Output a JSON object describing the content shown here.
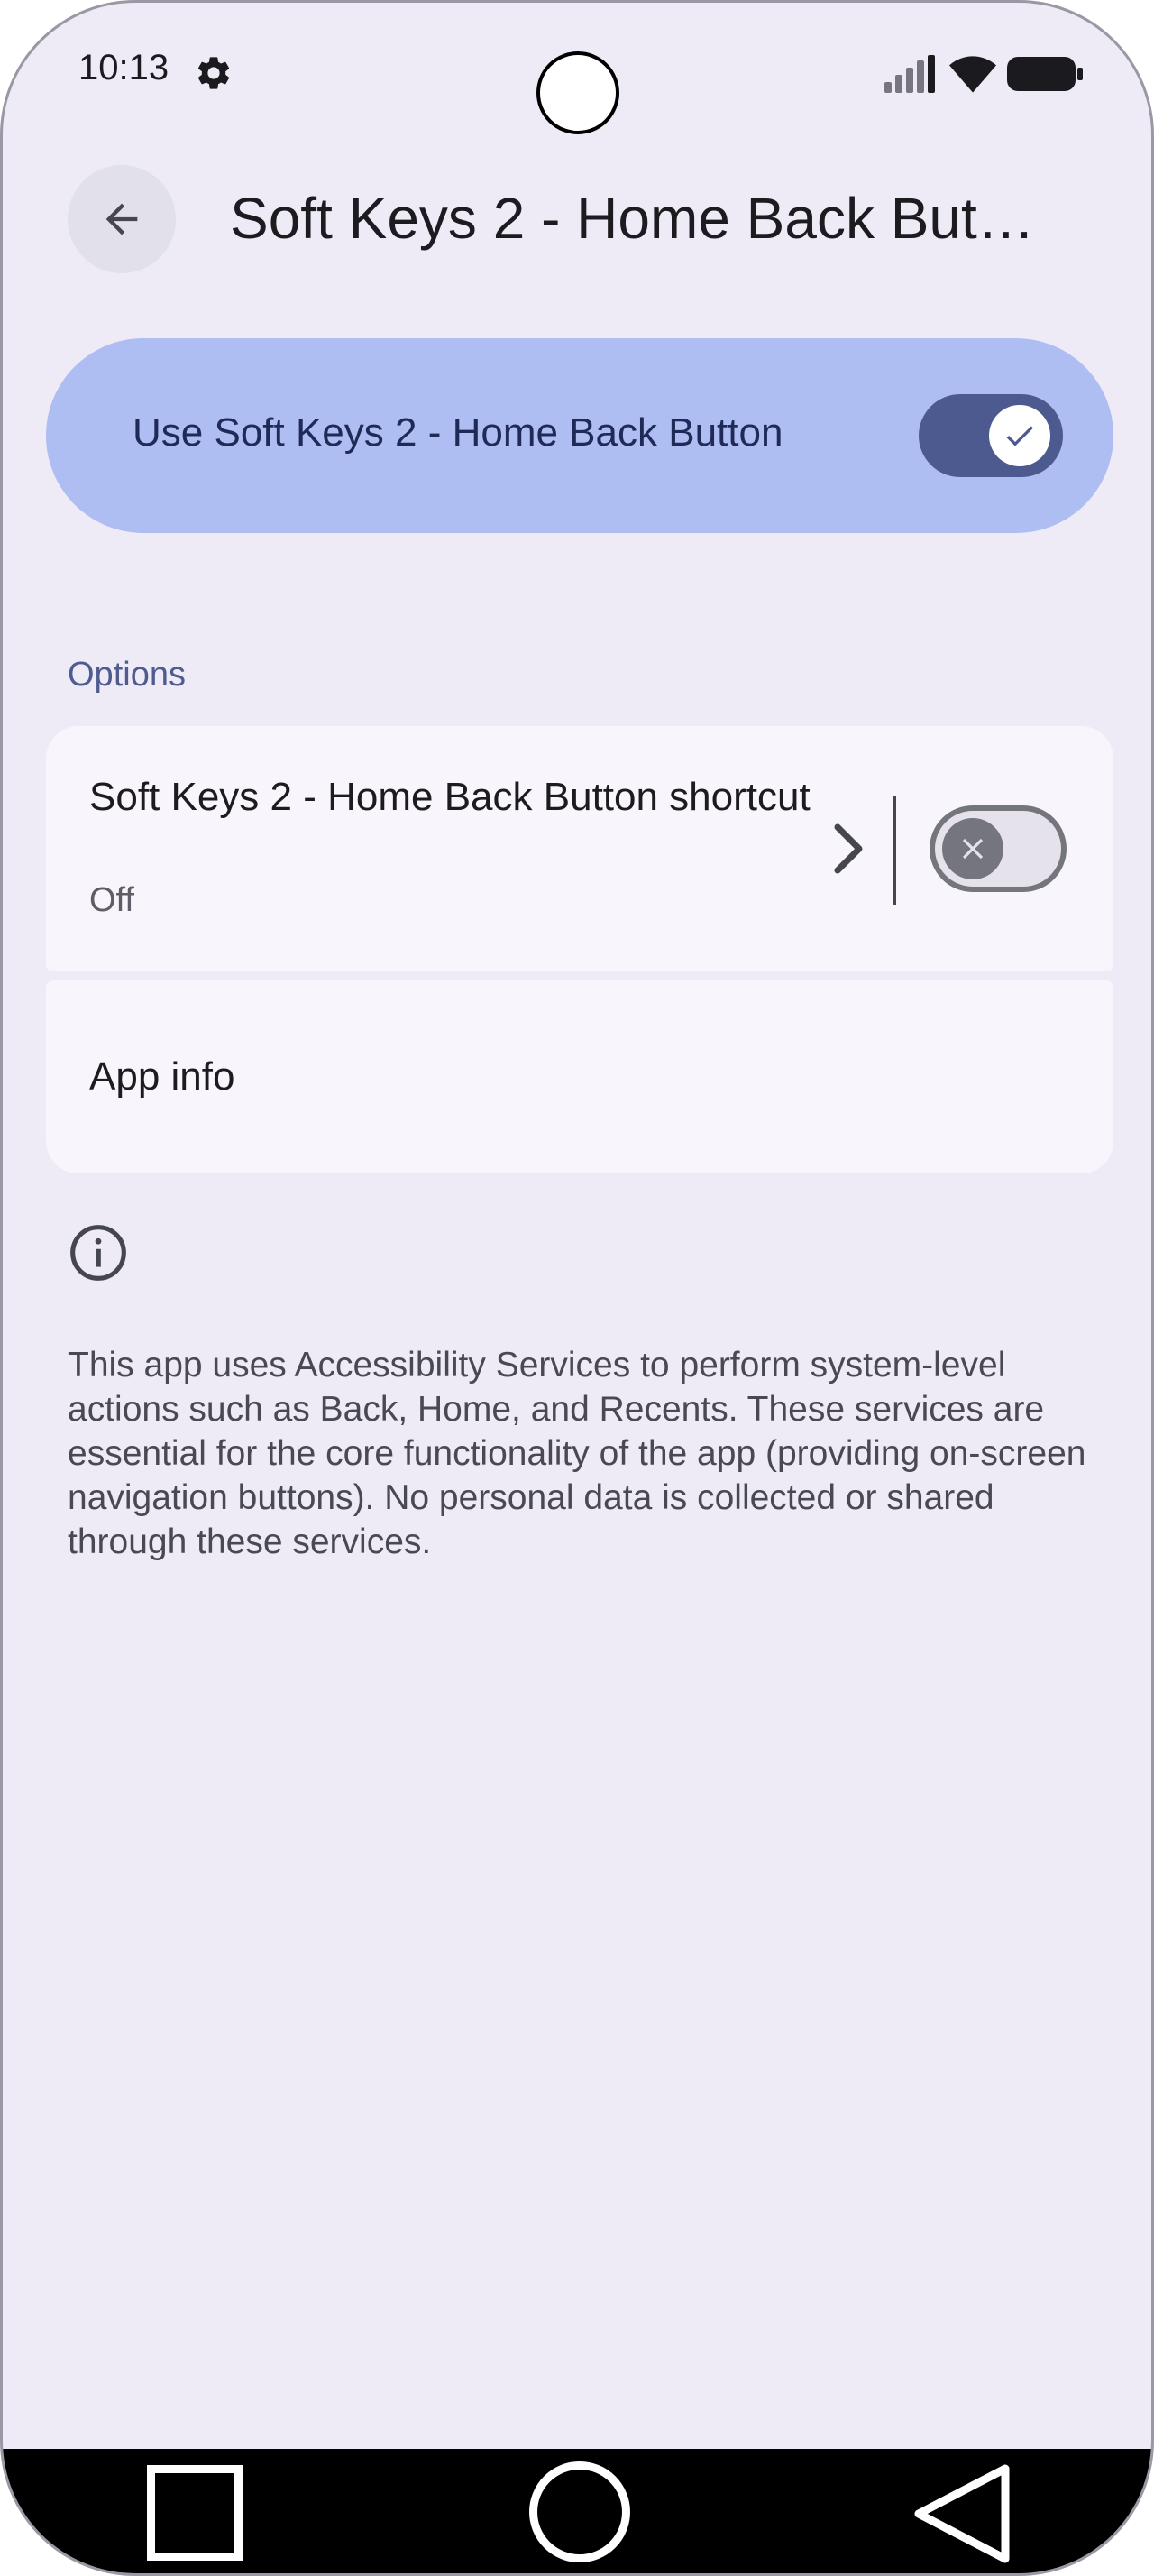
{
  "status_bar": {
    "time": "10:13",
    "icons": [
      "gear-icon",
      "signal-icon",
      "wifi-icon",
      "battery-icon"
    ]
  },
  "header": {
    "back_icon": "arrow-back-icon",
    "title": "Soft Keys 2 - Home Back Butt…"
  },
  "main_switch": {
    "label": "Use Soft Keys 2 - Home Back Button",
    "checked": true,
    "color": "#aebdf2"
  },
  "options": {
    "header": "Options",
    "shortcut": {
      "title": "Soft Keys 2 - Home Back Button shortcut",
      "summary": "Off",
      "checked": false
    },
    "app_info": {
      "title": "App info"
    }
  },
  "info": {
    "icon": "info-icon",
    "text": "This app uses Accessibility Services to perform system-level actions such as Back, Home, and Recents. These services are essential for the core functionality of the app (providing on-screen navigation buttons). No personal data is collected or shared through these services."
  },
  "nav_bar": {
    "icons": [
      "recents-icon",
      "home-icon",
      "back-triangle-icon"
    ]
  },
  "colors": {
    "background": "#eeebf6",
    "accent": "#4d5a8f",
    "card": "#f8f6fc"
  }
}
